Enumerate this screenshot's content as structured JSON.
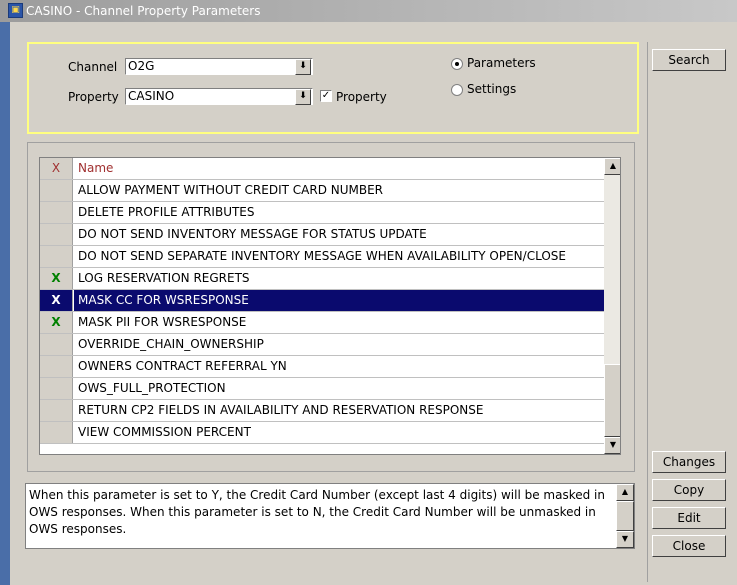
{
  "window": {
    "title": "CASINO - Channel Property Parameters",
    "app_icon": "hotel-app-icon"
  },
  "filters": {
    "channel_label": "Channel",
    "channel_value": "O2G",
    "property_label": "Property",
    "property_value": "CASINO",
    "property_checkbox_label": "Property",
    "property_checkbox_checked": true
  },
  "mode": {
    "parameters_label": "Parameters",
    "settings_label": "Settings",
    "selected": "Parameters"
  },
  "grid": {
    "columns": [
      "X",
      "Name"
    ],
    "rows": [
      {
        "x": "",
        "name": "ALLOW PAYMENT WITHOUT CREDIT CARD NUMBER"
      },
      {
        "x": "",
        "name": "DELETE PROFILE ATTRIBUTES"
      },
      {
        "x": "",
        "name": "DO NOT SEND INVENTORY MESSAGE FOR STATUS UPDATE"
      },
      {
        "x": "",
        "name": "DO NOT SEND SEPARATE INVENTORY MESSAGE WHEN AVAILABILITY OPEN/CLOSE"
      },
      {
        "x": "X",
        "name": "LOG RESERVATION REGRETS"
      },
      {
        "x": "X",
        "name": "MASK CC FOR WSRESPONSE"
      },
      {
        "x": "X",
        "name": "MASK PII FOR WSRESPONSE"
      },
      {
        "x": "",
        "name": "OVERRIDE_CHAIN_OWNERSHIP"
      },
      {
        "x": "",
        "name": "OWNERS CONTRACT REFERRAL YN"
      },
      {
        "x": "",
        "name": "OWS_FULL_PROTECTION"
      },
      {
        "x": "",
        "name": "RETURN CP2 FIELDS IN AVAILABILITY AND RESERVATION RESPONSE"
      },
      {
        "x": "",
        "name": "VIEW COMMISSION PERCENT"
      }
    ],
    "selected_row": "MASK CC FOR WSRESPONSE"
  },
  "description": "When this parameter is set to Y, the Credit Card Number (except last 4 digits) will be masked in OWS responses. When this parameter is set to N, the Credit Card Number will be unmasked in OWS responses.",
  "buttons": {
    "search": "Search",
    "changes": "Changes",
    "copy": "Copy",
    "edit": "Edit",
    "close": "Close"
  },
  "colors": {
    "selection": "#0a0a6e",
    "check_mark": "#008000",
    "filter_border": "#ffff80"
  }
}
